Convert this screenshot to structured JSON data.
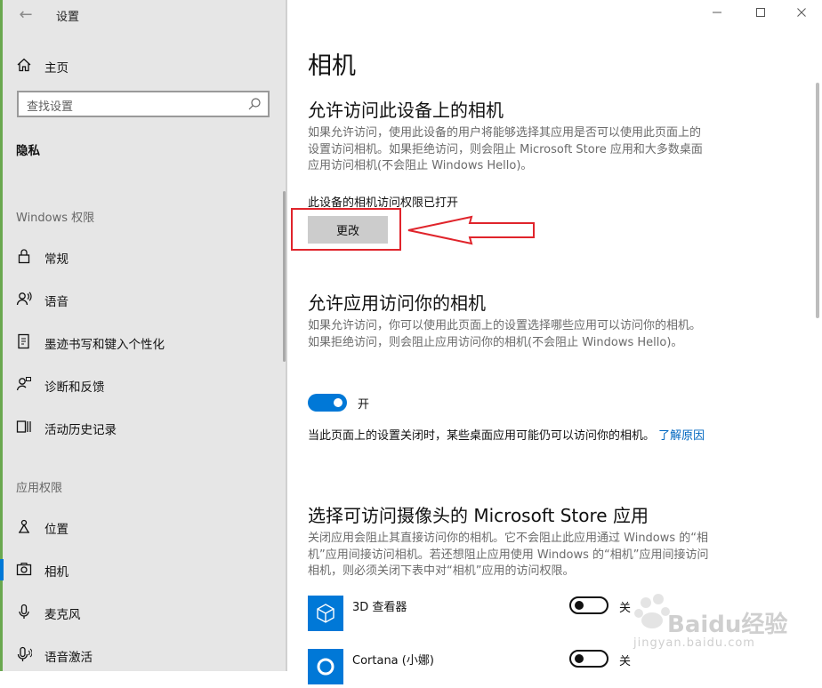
{
  "window": {
    "title": "设置",
    "controls": [
      "minimize",
      "maximize",
      "close"
    ]
  },
  "sidebar": {
    "home_label": "主页",
    "search_placeholder": "查找设置",
    "category": "隐私",
    "section_windows": "Windows 权限",
    "windows_items": [
      {
        "label": "常规",
        "icon": "lock-icon"
      },
      {
        "label": "语音",
        "icon": "speech-icon"
      },
      {
        "label": "墨迹书写和键入个性化",
        "icon": "inking-icon"
      },
      {
        "label": "诊断和反馈",
        "icon": "feedback-icon"
      },
      {
        "label": "活动历史记录",
        "icon": "activity-icon"
      }
    ],
    "section_apps": "应用权限",
    "app_items": [
      {
        "label": "位置",
        "icon": "location-icon"
      },
      {
        "label": "相机",
        "icon": "camera-icon",
        "selected": true
      },
      {
        "label": "麦克风",
        "icon": "microphone-icon"
      },
      {
        "label": "语音激活",
        "icon": "voice-activation-icon"
      }
    ]
  },
  "main": {
    "page_title": "相机",
    "device_section": {
      "heading": "允许访问此设备上的相机",
      "description": "如果允许访问，使用此设备的用户将能够选择其应用是否可以使用此页面上的设置访问相机。如果拒绝访问，则会阻止 Microsoft Store 应用和大多数桌面应用访问相机(不会阻止 Windows Hello)。",
      "status": "此设备的相机访问权限已打开",
      "change_button": "更改"
    },
    "app_access_section": {
      "heading": "允许应用访问你的相机",
      "description": "如果允许访问，你可以使用此页面上的设置选择哪些应用可以访问你的相机。如果拒绝访问，则会阻止应用访问你的相机(不会阻止 Windows Hello)。",
      "toggle_label": "开",
      "toggle_on": true,
      "note": "当此页面上的设置关闭时，某些桌面应用可能仍可以访问你的相机。",
      "note_link": "了解原因"
    },
    "store_apps_section": {
      "heading": "选择可访问摄像头的 Microsoft Store 应用",
      "description": "关闭应用会阻止其直接访问你的相机。它不会阻止此应用通过 Windows 的“相机”应用间接访问相机。若还想阻止应用使用 Windows 的“相机”应用间接访问相机，则必须关闭下表中对“相机”应用的访问权限。",
      "apps": [
        {
          "name": "3D 查看器",
          "toggle_label": "关",
          "on": false,
          "icon": "cube-icon"
        },
        {
          "name": "Cortana (小娜)",
          "toggle_label": "关",
          "on": false,
          "icon": "cortana-icon"
        }
      ]
    }
  },
  "annotation": {
    "color": "#e0242b"
  },
  "watermark": {
    "text": "Baidu经验",
    "sub": "jingyan.baidu.com"
  },
  "colors": {
    "accent": "#0078d7",
    "sidebar_bg": "#e6e6e6",
    "annotation_red": "#e0242b"
  }
}
